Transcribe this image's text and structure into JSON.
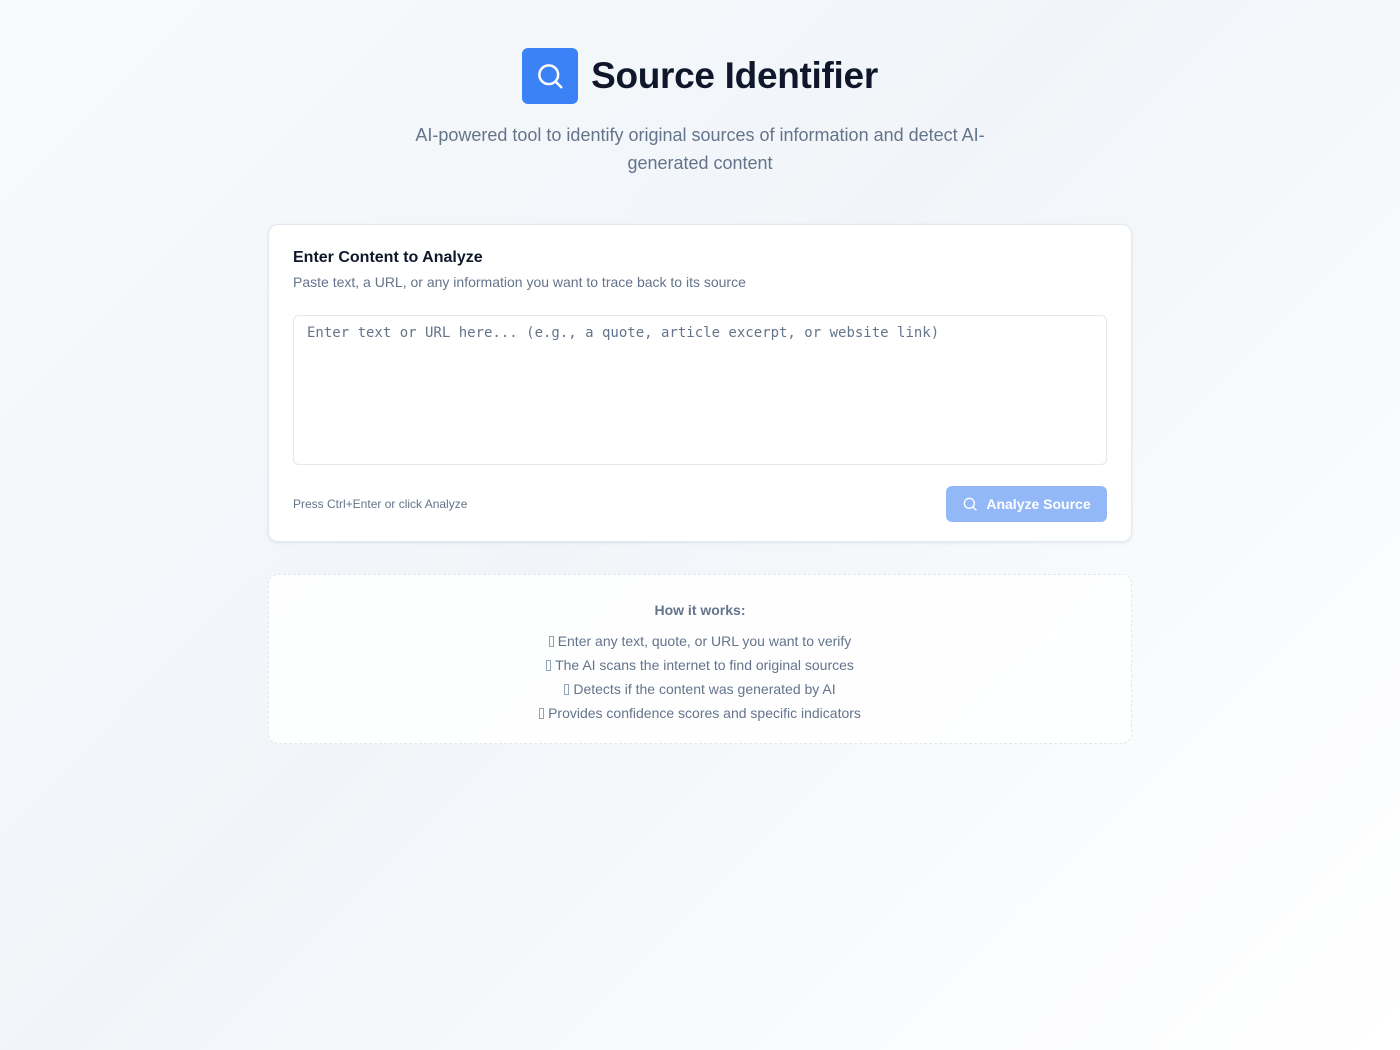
{
  "header": {
    "logo_icon": "search-icon",
    "title": "Source Identifier",
    "subtitle": "AI-powered tool to identify original sources of information and detect AI-generated content"
  },
  "analyze_card": {
    "title": "Enter Content to Analyze",
    "description": "Paste text, a URL, or any information you want to trace back to its source",
    "input": {
      "value": "",
      "placeholder": "Enter text or URL here... (e.g., a quote, article excerpt, or website link)"
    },
    "hint": "Press Ctrl+Enter or click Analyze",
    "button": {
      "label": "Analyze Source",
      "icon": "search-icon",
      "state": "disabled"
    }
  },
  "how_it_works": {
    "heading": "How it works:",
    "steps": [
      "Enter any text, quote, or URL you want to verify",
      "The AI scans the internet to find original sources",
      "Detects if the content was generated by AI",
      "Provides confidence scores and specific indicators"
    ]
  },
  "colors": {
    "accent": "#3b82f6",
    "button_disabled": "#93b8f7",
    "text_primary": "#0f172a",
    "text_muted": "#64748b",
    "border": "#e2e8f0"
  }
}
